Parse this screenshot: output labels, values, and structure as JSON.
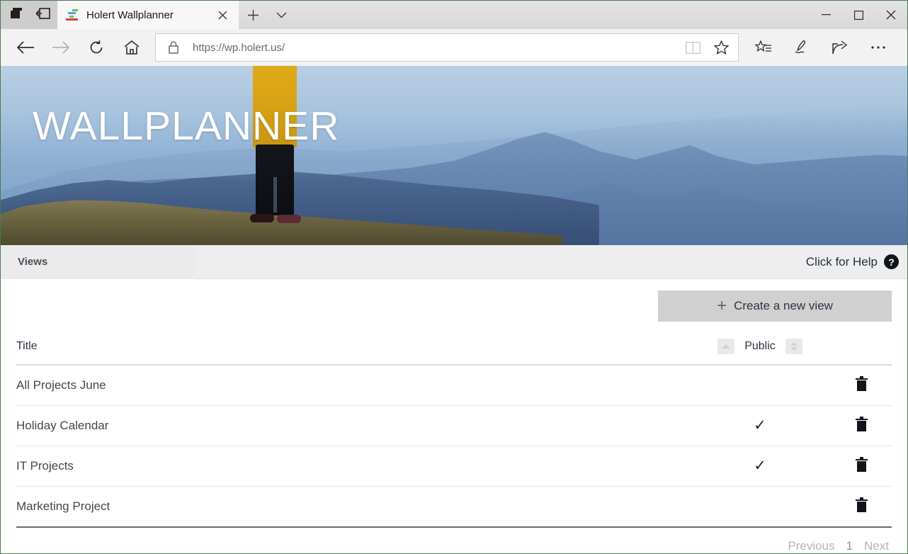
{
  "browser": {
    "system_buttons": [
      {
        "name": "tab-preview-button",
        "icon": "windows-stack-icon"
      },
      {
        "name": "set-aside-tabs-button",
        "icon": "set-aside-icon"
      }
    ],
    "tab": {
      "title": "Holert Wallplanner",
      "favicon": "gantt-chart-icon",
      "close_label": "✕"
    },
    "new_tab_label": "+",
    "tab_menu_label": "⌄",
    "window_controls": {
      "minimize": "—",
      "maximize": "□",
      "close": "✕"
    },
    "nav": {
      "back": "←",
      "forward": "→",
      "refresh": "↻",
      "home": "home-icon"
    },
    "address": {
      "lock_icon": "lock-icon",
      "scheme": "https://",
      "host": "wp.holert.us",
      "path": "/",
      "full_url": "https://wp.holert.us/",
      "reading_view_icon": "book-icon",
      "favorite_icon": "star-icon"
    },
    "toolbar": [
      {
        "name": "favorites-hub-button",
        "icon": "star-list-icon"
      },
      {
        "name": "web-note-button",
        "icon": "pen-icon"
      },
      {
        "name": "share-button",
        "icon": "share-icon"
      },
      {
        "name": "settings-button",
        "icon": "ellipsis-icon"
      }
    ]
  },
  "page": {
    "hero": {
      "title": "WALLPLANNER",
      "image_description": "hiker in yellow jacket on ridge overlooking blue hazy mountains"
    },
    "views_bar": {
      "tab_label": "Views",
      "help_text": "Click for Help",
      "help_icon": "question-mark-icon"
    },
    "create_button": {
      "label": "Create a new view",
      "icon": "plus-icon"
    },
    "table": {
      "columns": [
        {
          "key": "title",
          "label": "Title"
        },
        {
          "key": "public",
          "label": "Public"
        },
        {
          "key": "actions",
          "label": ""
        }
      ],
      "sort_controls": [
        {
          "name": "sort-ascending-button",
          "icon": "triangle-up-icon",
          "state": "active"
        },
        {
          "name": "sort-toggle-button",
          "icon": "triangle-up-down-icon",
          "state": "inactive"
        }
      ],
      "rows": [
        {
          "title": "All Projects June",
          "public": false,
          "delete_icon": "trash-icon"
        },
        {
          "title": "Holiday Calendar",
          "public": true,
          "delete_icon": "trash-icon"
        },
        {
          "title": "IT Projects",
          "public": true,
          "delete_icon": "trash-icon"
        },
        {
          "title": "Marketing Project",
          "public": false,
          "delete_icon": "trash-icon"
        }
      ],
      "check_glyph": "✓"
    },
    "pagination": {
      "previous_label": "Previous",
      "current_page": "1",
      "next_label": "Next"
    }
  },
  "colors": {
    "hero_sky": "#a8c3dd",
    "jacket": "#d9a316",
    "views_bar_bg": "#eeeeee",
    "create_button_bg": "#d0d0d0",
    "text_dark": "#41484f",
    "pager_muted": "#b5b5b5"
  }
}
